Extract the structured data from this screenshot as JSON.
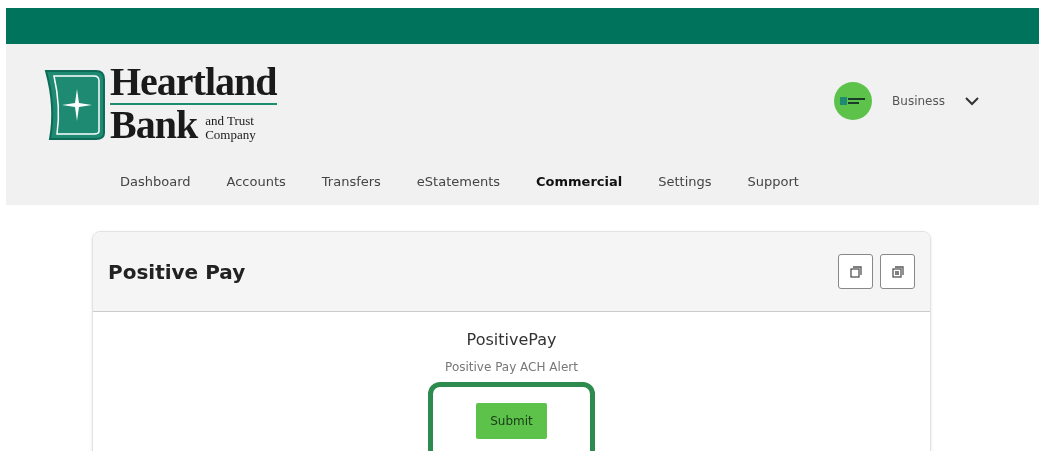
{
  "logo": {
    "name_line1": "Heartland",
    "name_line2": "Bank",
    "sub_line1": "and Trust",
    "sub_line2": "Company"
  },
  "account": {
    "label": "Business"
  },
  "nav": [
    {
      "label": "Dashboard",
      "selected": false
    },
    {
      "label": "Accounts",
      "selected": false
    },
    {
      "label": "Transfers",
      "selected": false
    },
    {
      "label": "eStatements",
      "selected": false
    },
    {
      "label": "Commercial",
      "selected": true
    },
    {
      "label": "Settings",
      "selected": false
    },
    {
      "label": "Support",
      "selected": false
    }
  ],
  "card": {
    "title": "Positive Pay",
    "heading": "PositivePay",
    "subheading": "Positive Pay ACH Alert",
    "submit": "Submit",
    "highlighted": true
  }
}
